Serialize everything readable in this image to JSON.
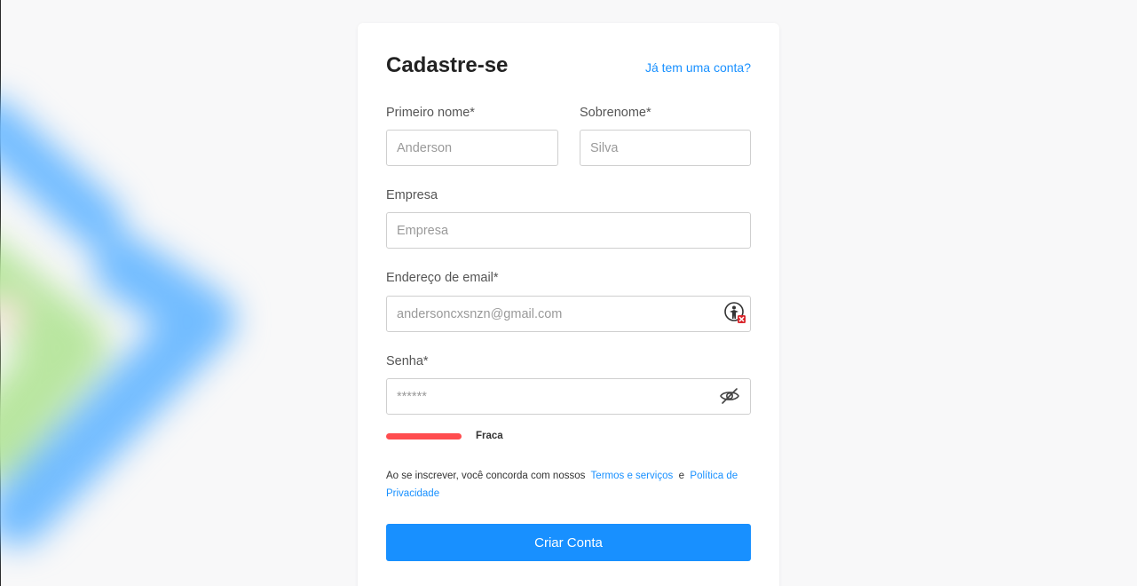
{
  "form": {
    "title": "Cadastre-se",
    "login_link": "Já tem uma conta?",
    "first_name": {
      "label": "Primeiro nome*",
      "placeholder": "Anderson"
    },
    "last_name": {
      "label": "Sobrenome*",
      "placeholder": "Silva"
    },
    "company": {
      "label": "Empresa",
      "placeholder": "Empresa"
    },
    "email": {
      "label": "Endereço de email*",
      "placeholder": "andersoncxsnzn@gmail.com",
      "icon": "password-manager-icon"
    },
    "password": {
      "label": "Senha*",
      "placeholder": "******",
      "icon": "eye-slash-icon"
    },
    "strength": {
      "label": "Fraca",
      "color": "#ff4d4f"
    },
    "terms": {
      "prefix": "Ao se inscrever, você concorda com nossos",
      "terms_link": "Termos e serviços",
      "connector": "e",
      "privacy_link": "Política de Privacidade"
    },
    "submit_label": "Criar Conta"
  },
  "colors": {
    "accent": "#1890ff",
    "background": "#f8f8f9",
    "card": "#ffffff",
    "danger": "#ff4d4f"
  }
}
